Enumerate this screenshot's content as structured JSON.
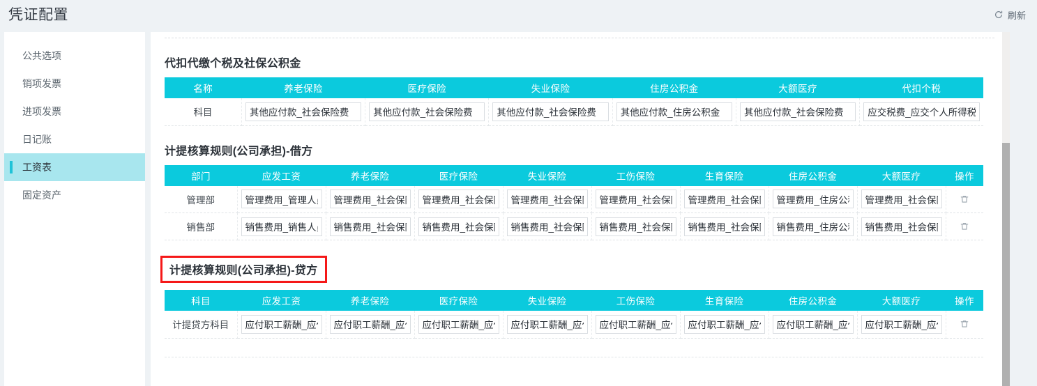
{
  "header": {
    "title": "凭证配置",
    "refresh_label": "刷新",
    "refresh_icon": "refresh-circular-arrow-icon"
  },
  "sidebar": {
    "items": [
      {
        "label": "公共选项",
        "active": false
      },
      {
        "label": "销项发票",
        "active": false
      },
      {
        "label": "进项发票",
        "active": false
      },
      {
        "label": "日记账",
        "active": false
      },
      {
        "label": "工资表",
        "active": true
      },
      {
        "label": "固定资产",
        "active": false
      }
    ]
  },
  "colors": {
    "table_header": "#0bcadd",
    "sidebar_active_bg": "#a8e6ee",
    "sidebar_active_bar": "#1fc3d8",
    "highlight_border": "#f51818",
    "page_bg": "#eef2f5"
  },
  "sections": [
    {
      "title": "代扣代缴个税及社保公积金",
      "highlighted": false,
      "has_action_column": false,
      "headers": [
        "名称",
        "养老保险",
        "医疗保险",
        "失业保险",
        "住房公积金",
        "大额医疗",
        "代扣个税"
      ],
      "rows": [
        {
          "label": "科目",
          "values": [
            "其他应付款_社会保险费",
            "其他应付款_社会保险费",
            "其他应付款_社会保险费",
            "其他应付款_住房公积金",
            "其他应付款_社会保险费",
            "应交税费_应交个人所得税"
          ]
        }
      ]
    },
    {
      "title": "计提核算规则(公司承担)-借方",
      "highlighted": false,
      "has_action_column": true,
      "action_header": "操作",
      "action_icon": "trash-icon",
      "headers": [
        "部门",
        "应发工资",
        "养老保险",
        "医疗保险",
        "失业保险",
        "工伤保险",
        "生育保险",
        "住房公积金",
        "大额医疗"
      ],
      "rows": [
        {
          "label": "管理部",
          "values": [
            "管理费用_管理人员",
            "管理费用_社会保险费",
            "管理费用_社会保险费",
            "管理费用_社会保险费",
            "管理费用_社会保险费",
            "管理费用_社会保险费",
            "管理费用_住房公积金",
            "管理费用_社会保险费"
          ]
        },
        {
          "label": "销售部",
          "values": [
            "销售费用_销售人员",
            "销售费用_社会保险费",
            "销售费用_社会保险费",
            "销售费用_社会保险费",
            "销售费用_社会保险费",
            "销售费用_社会保险费",
            "销售费用_住房公积金",
            "销售费用_社会保险费"
          ]
        }
      ]
    },
    {
      "title": "计提核算规则(公司承担)-贷方",
      "highlighted": true,
      "has_action_column": true,
      "action_header": "操作",
      "action_icon": "trash-icon",
      "headers": [
        "科目",
        "应发工资",
        "养老保险",
        "医疗保险",
        "失业保险",
        "工伤保险",
        "生育保险",
        "住房公积金",
        "大额医疗"
      ],
      "rows": [
        {
          "label": "计提贷方科目",
          "values": [
            "应付职工薪酬_应付",
            "应付职工薪酬_应付",
            "应付职工薪酬_应付",
            "应付职工薪酬_应付",
            "应付职工薪酬_应付",
            "应付职工薪酬_应付",
            "应付职工薪酬_应付",
            "应付职工薪酬_应付"
          ]
        }
      ]
    }
  ],
  "scrollbar": {
    "orientation": "vertical"
  }
}
